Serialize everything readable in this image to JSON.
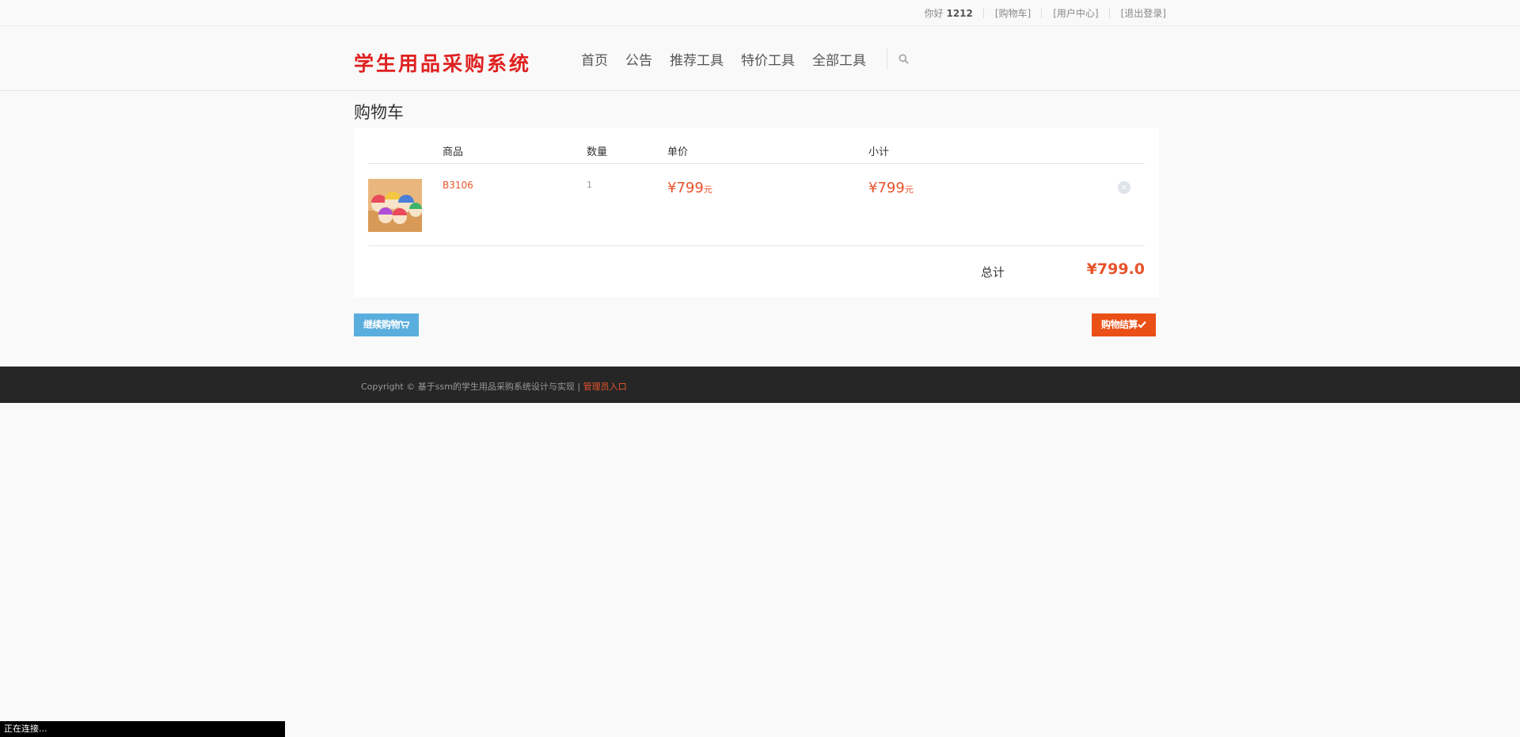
{
  "topbar": {
    "greeting": "你好",
    "username": "1212",
    "cart_link": "[购物车]",
    "user_center_link": "[用户中心]",
    "logout_link": "[退出登录]"
  },
  "header": {
    "logo": "学生用品采购系统",
    "nav": [
      "首页",
      "公告",
      "推荐工具",
      "特价工具",
      "全部工具"
    ],
    "search_icon": "search-icon"
  },
  "cart": {
    "title": "购物车",
    "columns": {
      "product": "商品",
      "quantity": "数量",
      "unit_price": "单价",
      "subtotal": "小计"
    },
    "items": [
      {
        "name": "B3106",
        "quantity": "1",
        "price_symbol": "¥",
        "price": "799",
        "price_unit": "元",
        "subtotal_symbol": "¥",
        "subtotal": "799",
        "subtotal_unit": "元",
        "remove_icon": "close-icon"
      }
    ],
    "total_label": "总计",
    "total_value": "¥799.0"
  },
  "buttons": {
    "continue_shopping": "继续购物",
    "checkout": "购物结算"
  },
  "footer": {
    "copyright": "Copyright © 基于ssm的学生用品采购系统设计与实现 |",
    "admin_link": "管理员入口"
  },
  "status_bar": "正在连接...",
  "colors": {
    "accent": "#e8532b",
    "logo": "#e02020",
    "continue_button": "#5aaede",
    "checkout_button": "#ea4f16",
    "footer_bg": "#262626"
  }
}
